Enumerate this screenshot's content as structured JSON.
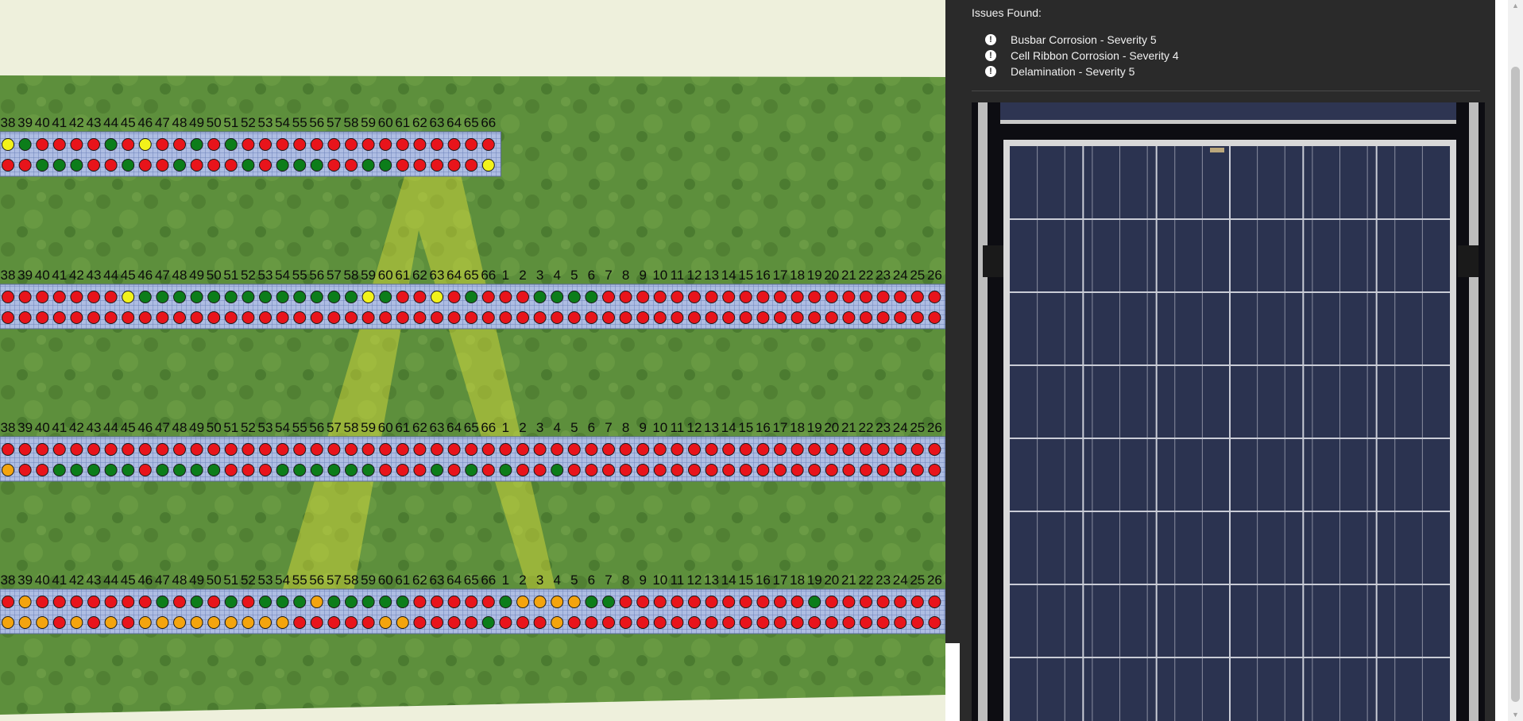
{
  "issues": {
    "title": "Issues Found:",
    "items": [
      {
        "label": "Busbar Corrosion - Severity 5",
        "icon": "exclamation-circle-icon"
      },
      {
        "label": "Cell Ribbon Corrosion - Severity 4",
        "icon": "exclamation-circle-icon"
      },
      {
        "label": "Delamination - Severity 5",
        "icon": "exclamation-circle-icon"
      }
    ]
  },
  "colors": {
    "red": "#e8141b",
    "green": "#0c7d1a",
    "yellow": "#f2f21a",
    "orange": "#f4a40e",
    "panel_background": "#2a2a2a",
    "highlight": "#e3e23a"
  },
  "map": {
    "rows": [
      {
        "labels": [
          "38",
          "39",
          "40",
          "41",
          "42",
          "43",
          "44",
          "45",
          "46",
          "47",
          "48",
          "49",
          "50",
          "51",
          "52",
          "53",
          "54",
          "55",
          "56",
          "57",
          "58",
          "59",
          "60",
          "61",
          "62",
          "63",
          "64",
          "65",
          "66"
        ],
        "top_status": "YGRRRRGRYRRGRGRRRRRRRRRRRRRRR",
        "bottom_status": "RRGGGRRGRRGRRRGRGGGRRGGRRRRRY"
      },
      {
        "labels": [
          "38",
          "39",
          "40",
          "41",
          "42",
          "43",
          "44",
          "45",
          "46",
          "47",
          "48",
          "49",
          "50",
          "51",
          "52",
          "53",
          "54",
          "55",
          "56",
          "57",
          "58",
          "59",
          "60",
          "61",
          "62",
          "63",
          "64",
          "65",
          "66",
          "1",
          "2",
          "3",
          "4",
          "5",
          "6",
          "7",
          "8",
          "9",
          "10",
          "11",
          "12",
          "13",
          "14",
          "15",
          "16",
          "17",
          "18",
          "19",
          "20",
          "21",
          "22",
          "23",
          "24",
          "25",
          "26"
        ],
        "top_status": "RRRRRRRYGGGGGGGGGGGGGYGRRYRGRRRGGGGRRRRRRRRRRRRRRRRRRRR",
        "bottom_status": "RRRRRRRRRRRRRRRRRRRRRRRRRRRRRRRRRRRRRRRRRRRRRRRRRRRRRRR"
      },
      {
        "labels": [
          "38",
          "39",
          "40",
          "41",
          "42",
          "43",
          "44",
          "45",
          "46",
          "47",
          "48",
          "49",
          "50",
          "51",
          "52",
          "53",
          "54",
          "55",
          "56",
          "57",
          "58",
          "59",
          "60",
          "61",
          "62",
          "63",
          "64",
          "65",
          "66",
          "1",
          "2",
          "3",
          "4",
          "5",
          "6",
          "7",
          "8",
          "9",
          "10",
          "11",
          "12",
          "13",
          "14",
          "15",
          "16",
          "17",
          "18",
          "19",
          "20",
          "21",
          "22",
          "23",
          "24",
          "25",
          "26"
        ],
        "top_status": "RRRRRRRRRRRRRRRRRRRRRRRRRRRRRRRRRRRRRRRRRRRRRRRRRRRRRRR",
        "bottom_status": "ORRGGGGGRGGGGRRRGGGGGGRRRGRGRGRRGRRRRRRRRRRRRRRRRRRRRRR"
      },
      {
        "labels": [
          "38",
          "39",
          "40",
          "41",
          "42",
          "43",
          "44",
          "45",
          "46",
          "47",
          "48",
          "49",
          "50",
          "51",
          "52",
          "53",
          "54",
          "55",
          "56",
          "57",
          "58",
          "59",
          "60",
          "61",
          "62",
          "63",
          "64",
          "65",
          "66",
          "1",
          "2",
          "3",
          "4",
          "5",
          "6",
          "7",
          "8",
          "9",
          "10",
          "11",
          "12",
          "13",
          "14",
          "15",
          "16",
          "17",
          "18",
          "19",
          "20",
          "21",
          "22",
          "23",
          "24",
          "25",
          "26"
        ],
        "top_status": "RORRRRRRRGRGRGRGGGOGGGGGRRRRRGOOOOGGRRRRRRRRRRRGRRRRRRR",
        "bottom_status": "OOOROROROOOOOOOOORRRRROORRRRGRRRORRRRRRRRRRRRRRRRRRRRRR"
      }
    ]
  }
}
